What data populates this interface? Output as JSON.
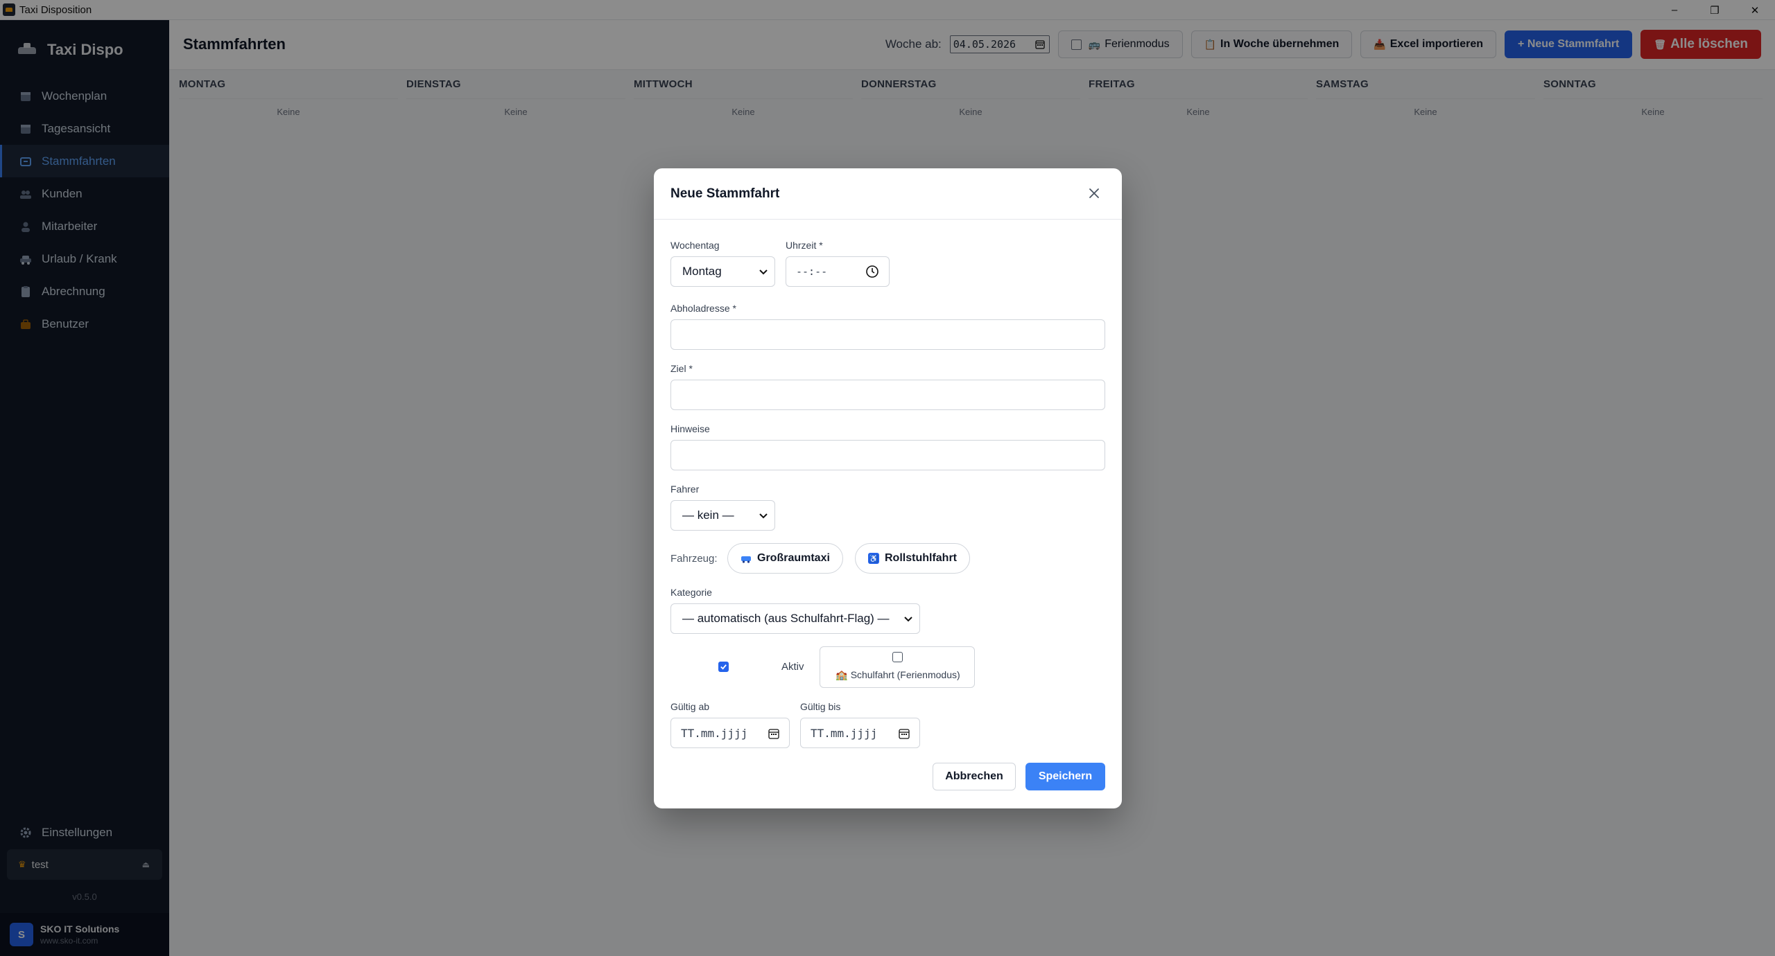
{
  "window": {
    "title": "Taxi Disposition",
    "controls": [
      "–",
      "❐",
      "✕"
    ]
  },
  "sidebar": {
    "brand": "Taxi Dispo",
    "items": [
      {
        "label": "Wochenplan",
        "icon": "calendar-icon"
      },
      {
        "label": "Tagesansicht",
        "icon": "calendar-day-icon"
      },
      {
        "label": "Stammfahrten",
        "icon": "repeat-icon",
        "active": true
      },
      {
        "label": "Kunden",
        "icon": "users-icon"
      },
      {
        "label": "Mitarbeiter",
        "icon": "user-icon"
      },
      {
        "label": "Urlaub / Krank",
        "icon": "car-icon"
      },
      {
        "label": "Abrechnung",
        "icon": "clipboard-icon"
      },
      {
        "label": "Benutzer",
        "icon": "briefcase-icon"
      }
    ],
    "settings_label": "Einstellungen",
    "user_name": "test",
    "version": "v0.5.0",
    "company_name": "SKO IT Solutions",
    "company_url": "www.sko-it.com",
    "company_badge": "S"
  },
  "header": {
    "title": "Stammfahrten",
    "week_label": "Woche ab:",
    "week_date": "04.05.2026",
    "ferienmodus_label": "Ferienmodus",
    "in_woche_label": "In Woche übernehmen",
    "excel_label": "Excel importieren",
    "neue_label": "+ Neue Stammfahrt",
    "alle_loeschen_label": "Alle löschen"
  },
  "days": {
    "headers": [
      "MONTAG",
      "DIENSTAG",
      "MITTWOCH",
      "DONNERSTAG",
      "FREITAG",
      "SAMSTAG",
      "SONNTAG"
    ],
    "empty_text": "Keine"
  },
  "modal": {
    "title": "Neue Stammfahrt",
    "wochentag_label": "Wochentag",
    "wochentag_value": "Montag",
    "uhrzeit_label": "Uhrzeit *",
    "uhrzeit_placeholder": "--:--",
    "abholadresse_label": "Abholadresse *",
    "ziel_label": "Ziel *",
    "hinweise_label": "Hinweise",
    "fahrer_label": "Fahrer",
    "fahrer_value": "— kein —",
    "fahrzeug_label": "Fahrzeug:",
    "grossraumtaxi_label": "Großraumtaxi",
    "rollstuhl_label": "Rollstuhlfahrt",
    "kategorie_label": "Kategorie",
    "kategorie_value": "— automatisch (aus Schulfahrt-Flag) —",
    "aktiv_label": "Aktiv",
    "aktiv_checked": true,
    "schulfahrt_label": "Schulfahrt (Ferienmodus)",
    "gueltig_ab_label": "Gültig ab",
    "gueltig_bis_label": "Gültig bis",
    "date_placeholder": "TT.mm.jjjj",
    "cancel_label": "Abbrechen",
    "save_label": "Speichern"
  },
  "colors": {
    "sidebar_bg": "#111827",
    "accent": "#3b82f6",
    "danger": "#dc2626"
  }
}
